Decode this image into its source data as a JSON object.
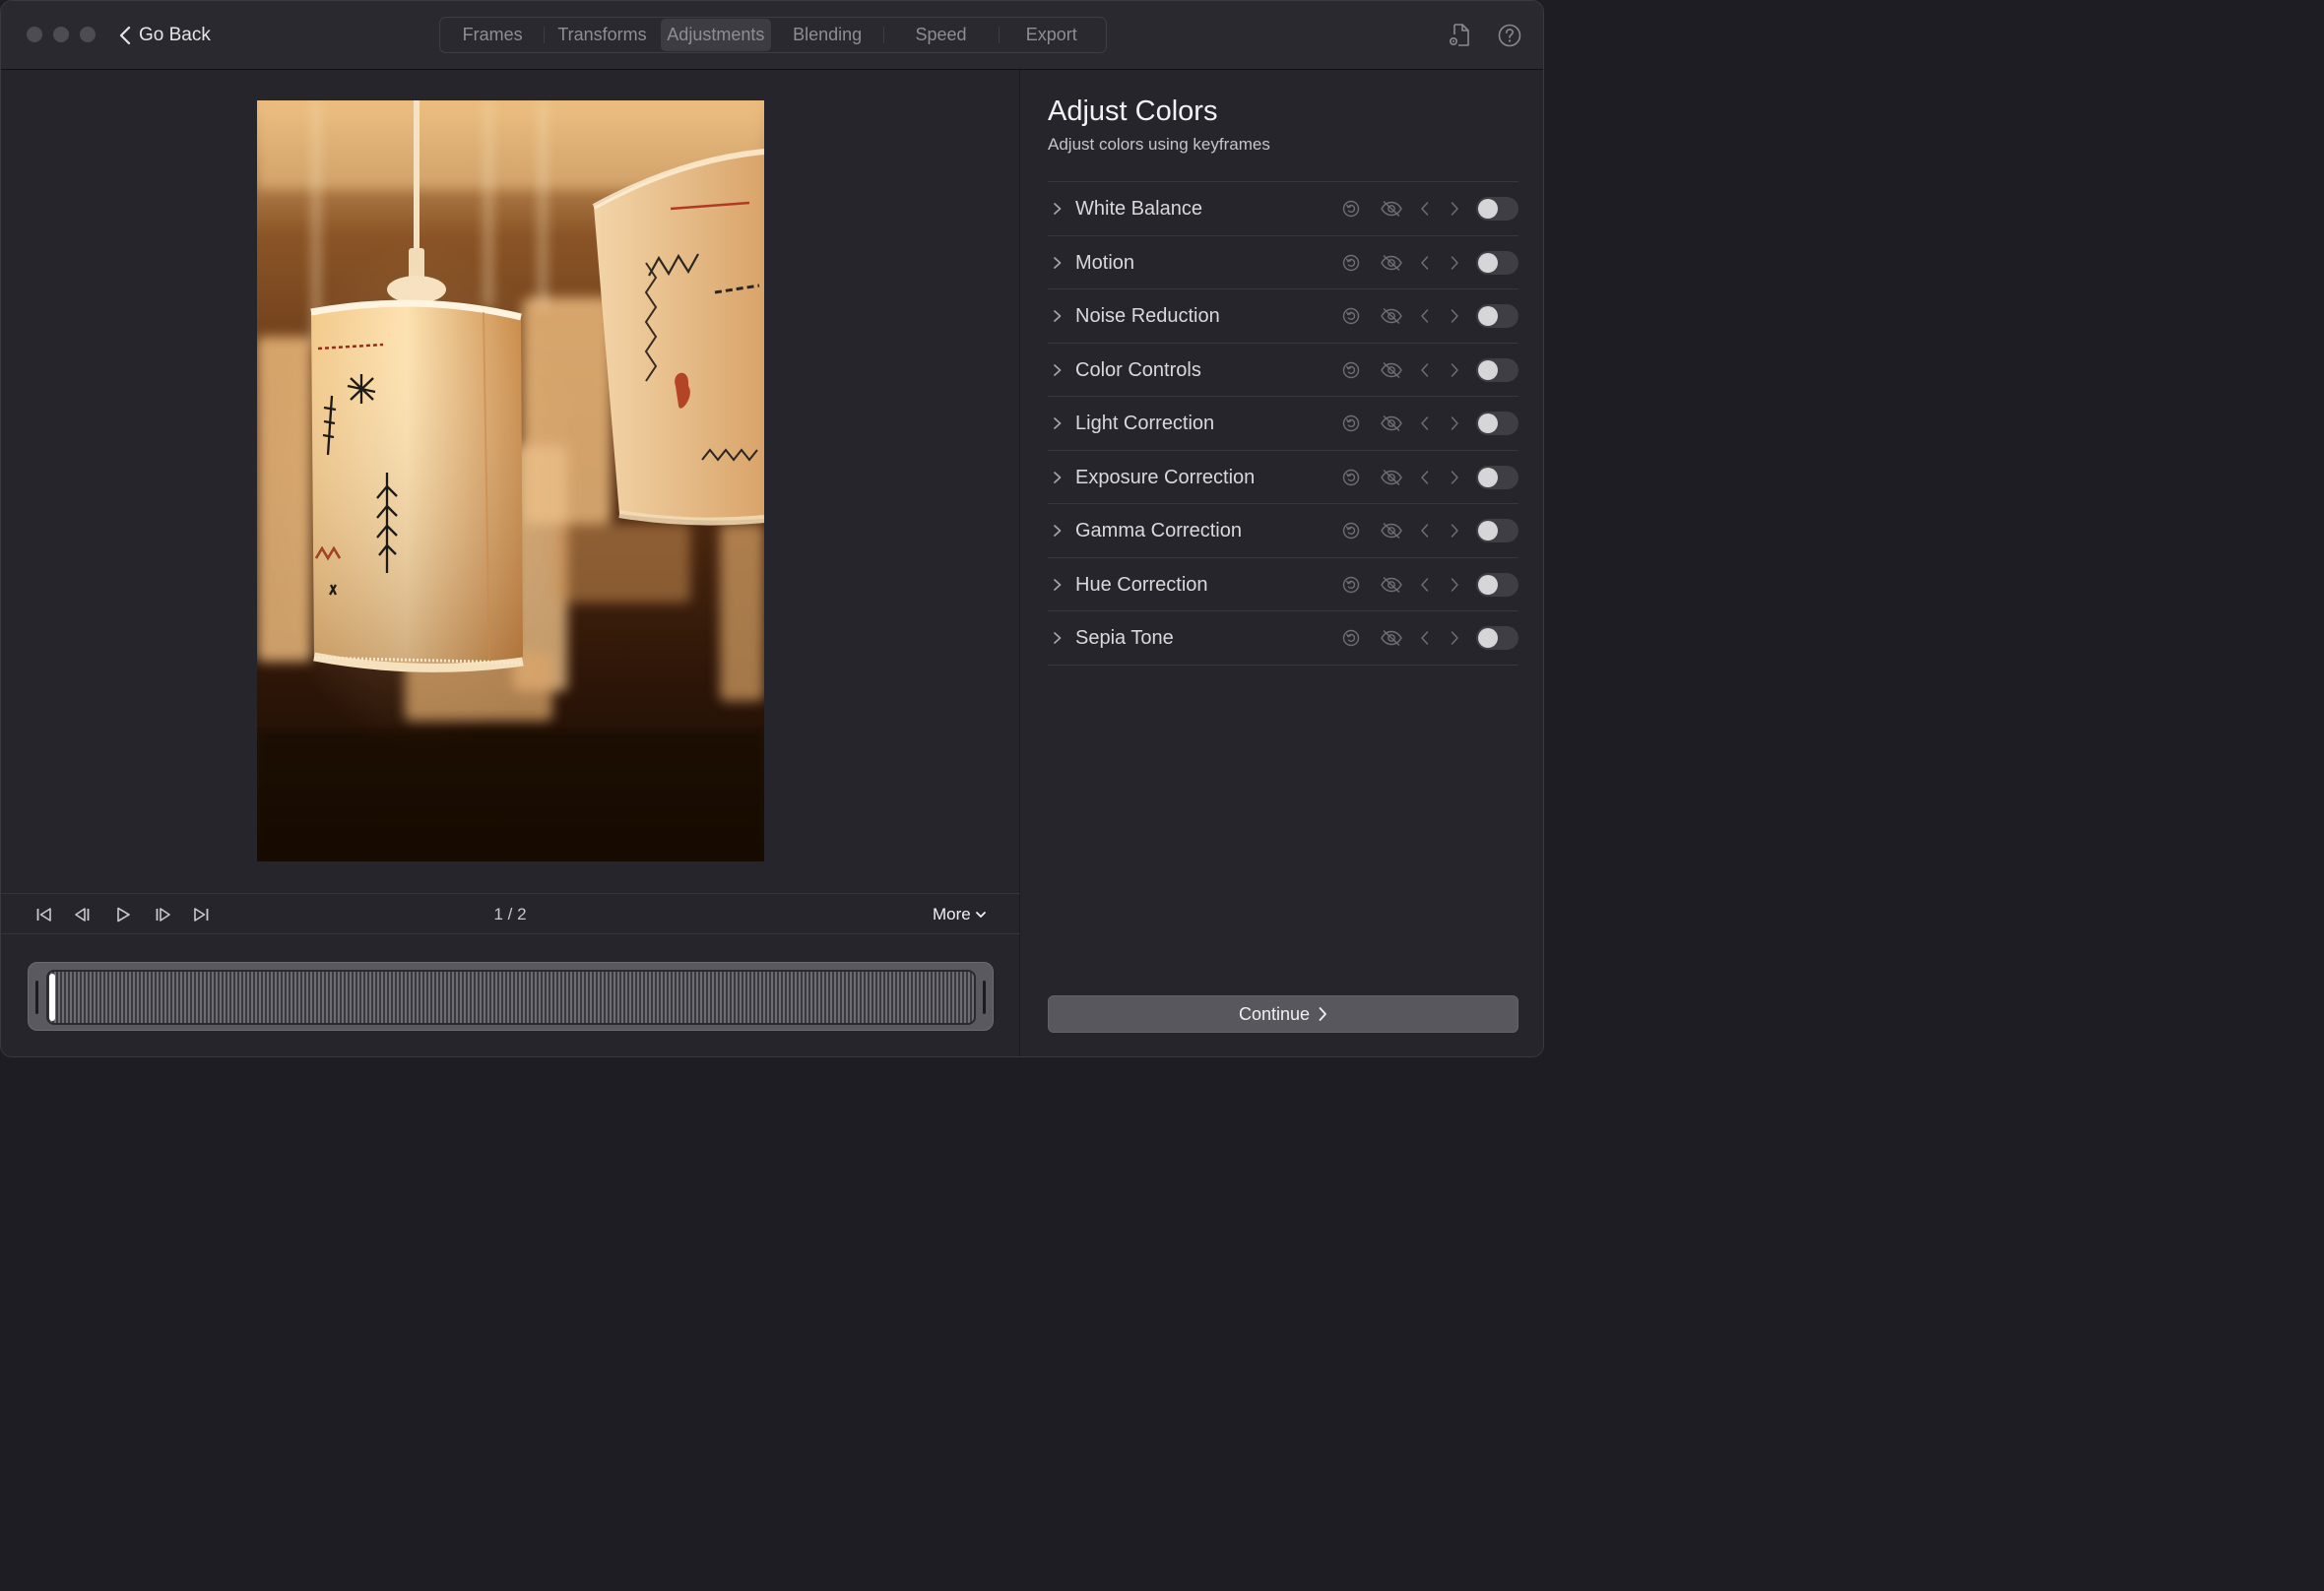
{
  "toolbar": {
    "back_label": "Go Back",
    "tabs": [
      {
        "label": "Frames"
      },
      {
        "label": "Transforms"
      },
      {
        "label": "Adjustments"
      },
      {
        "label": "Blending"
      },
      {
        "label": "Speed"
      },
      {
        "label": "Export"
      }
    ],
    "active_tab": "Adjustments",
    "icons": [
      "document-settings-icon",
      "help-icon"
    ]
  },
  "player": {
    "frame_counter": "1 / 2",
    "more_label": "More",
    "buttons": [
      "skip-to-start-icon",
      "step-back-icon",
      "play-icon",
      "step-forward-icon",
      "skip-to-end-icon"
    ],
    "playhead_position": 0
  },
  "panel": {
    "title": "Adjust Colors",
    "subtitle": "Adjust colors using keyframes",
    "adjustments": [
      {
        "label": "White Balance",
        "enabled": false
      },
      {
        "label": "Motion",
        "enabled": false
      },
      {
        "label": "Noise Reduction",
        "enabled": false
      },
      {
        "label": "Color Controls",
        "enabled": false
      },
      {
        "label": "Light Correction",
        "enabled": false
      },
      {
        "label": "Exposure Correction",
        "enabled": false
      },
      {
        "label": "Gamma Correction",
        "enabled": false
      },
      {
        "label": "Hue Correction",
        "enabled": false
      },
      {
        "label": "Sepia Tone",
        "enabled": false
      }
    ],
    "continue_label": "Continue"
  },
  "colors": {
    "window_bg": "#26252c",
    "toolbar_bg": "#2a2930",
    "toggle_off": "#3f3e45",
    "button_bg": "#58575e"
  }
}
